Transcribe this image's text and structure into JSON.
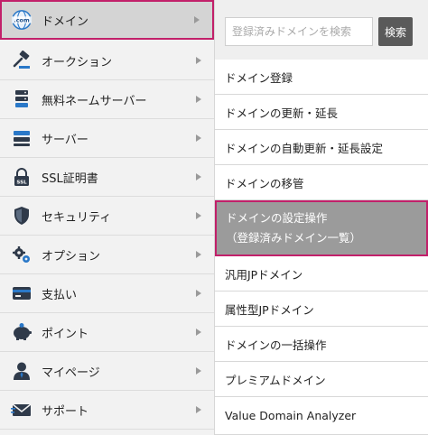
{
  "main_menu": [
    {
      "label": "ドメイン",
      "icon": "globe-com-icon",
      "active": true
    },
    {
      "label": "オークション",
      "icon": "gavel-icon",
      "active": false
    },
    {
      "label": "無料ネームサーバー",
      "icon": "server-stack-icon",
      "active": false
    },
    {
      "label": "サーバー",
      "icon": "server-icon",
      "active": false
    },
    {
      "label": "SSL証明書",
      "icon": "ssl-lock-icon",
      "active": false
    },
    {
      "label": "セキュリティ",
      "icon": "shield-icon",
      "active": false
    },
    {
      "label": "オプション",
      "icon": "gears-icon",
      "active": false
    },
    {
      "label": "支払い",
      "icon": "credit-card-icon",
      "active": false
    },
    {
      "label": "ポイント",
      "icon": "piggy-bank-icon",
      "active": false
    },
    {
      "label": "マイページ",
      "icon": "user-icon",
      "active": false
    },
    {
      "label": "サポート",
      "icon": "mail-icon",
      "active": false
    }
  ],
  "search": {
    "placeholder": "登録済みドメインを検索",
    "button_label": "検索"
  },
  "submenu": [
    {
      "label": "ドメイン登録"
    },
    {
      "label": "ドメインの更新・延長"
    },
    {
      "label": "ドメインの自動更新・延長設定"
    },
    {
      "label": "ドメインの移管"
    },
    {
      "label_line1": "ドメインの設定操作",
      "label_line2": "（登録済みドメイン一覧）",
      "active": true
    },
    {
      "label": "汎用JPドメイン"
    },
    {
      "label": "属性型JPドメイン"
    },
    {
      "label": "ドメインの一括操作"
    },
    {
      "label": "プレミアムドメイン"
    },
    {
      "label": "Value Domain Analyzer"
    }
  ],
  "colors": {
    "active_border": "#c2206a",
    "icon_dark": "#2f3a4a",
    "icon_blue": "#2a78c8"
  }
}
